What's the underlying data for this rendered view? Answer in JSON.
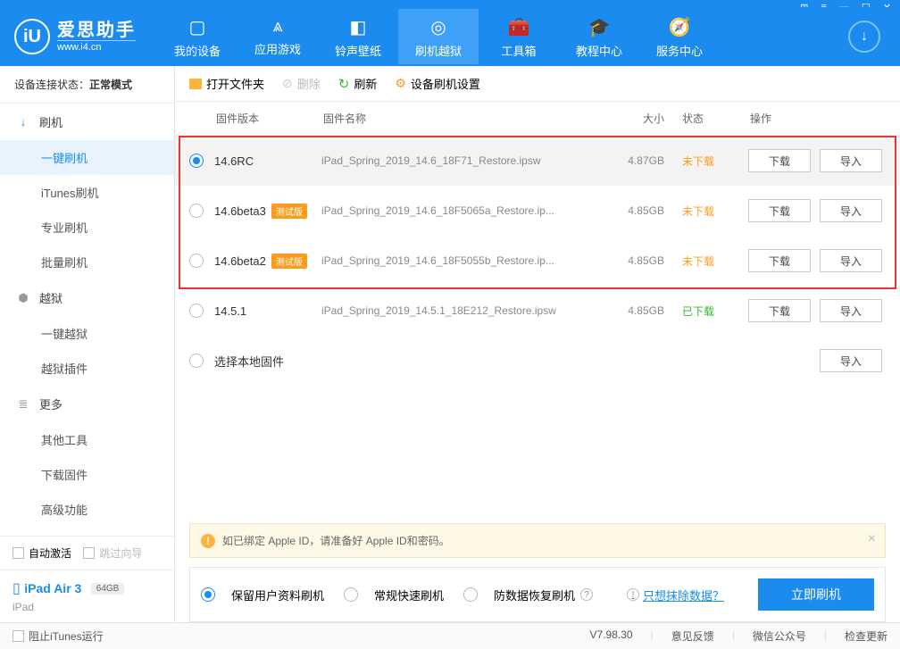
{
  "app": {
    "name": "爱思助手",
    "url": "www.i4.cn"
  },
  "nav": {
    "items": [
      {
        "label": "我的设备",
        "icon": "▢"
      },
      {
        "label": "应用游戏",
        "icon": "⩓"
      },
      {
        "label": "铃声壁纸",
        "icon": "◧"
      },
      {
        "label": "刷机越狱",
        "icon": "◎"
      },
      {
        "label": "工具箱",
        "icon": "🧰"
      },
      {
        "label": "教程中心",
        "icon": "🎓"
      },
      {
        "label": "服务中心",
        "icon": "🧭"
      }
    ],
    "active_index": 3
  },
  "conn": {
    "label": "设备连接状态：",
    "value": "正常模式"
  },
  "sidebar": {
    "flash": {
      "title": "刷机",
      "subs": [
        "一键刷机",
        "iTunes刷机",
        "专业刷机",
        "批量刷机"
      ]
    },
    "jailbreak": {
      "title": "越狱",
      "subs": [
        "一键越狱",
        "越狱插件"
      ]
    },
    "more": {
      "title": "更多",
      "subs": [
        "其他工具",
        "下载固件",
        "高级功能"
      ]
    },
    "auto_activate": "自动激活",
    "skip_guide": "跳过向导"
  },
  "device": {
    "name": "iPad Air 3",
    "storage": "64GB",
    "type": "iPad"
  },
  "toolbar": {
    "open": "打开文件夹",
    "delete": "删除",
    "refresh": "刷新",
    "settings": "设备刷机设置"
  },
  "columns": {
    "version": "固件版本",
    "name": "固件名称",
    "size": "大小",
    "status": "状态",
    "op": "操作"
  },
  "labels": {
    "download": "下载",
    "import": "导入",
    "beta_tag": "测试版",
    "not_downloaded": "未下载",
    "downloaded": "已下载"
  },
  "rows": [
    {
      "version": "14.6RC",
      "beta": false,
      "name": "iPad_Spring_2019_14.6_18F71_Restore.ipsw",
      "size": "4.87GB",
      "status": "nd",
      "selected": true
    },
    {
      "version": "14.6beta3",
      "beta": true,
      "name": "iPad_Spring_2019_14.6_18F5065a_Restore.ip...",
      "size": "4.85GB",
      "status": "nd",
      "selected": false
    },
    {
      "version": "14.6beta2",
      "beta": true,
      "name": "iPad_Spring_2019_14.6_18F5055b_Restore.ip...",
      "size": "4.85GB",
      "status": "nd",
      "selected": false
    },
    {
      "version": "14.5.1",
      "beta": false,
      "name": "iPad_Spring_2019_14.5.1_18E212_Restore.ipsw",
      "size": "4.85GB",
      "status": "dd",
      "selected": false
    }
  ],
  "local_row": {
    "label": "选择本地固件"
  },
  "warn": "如已绑定 Apple ID，请准备好 Apple ID和密码。",
  "flash_opts": {
    "keep": "保留用户资料刷机",
    "normal": "常规快速刷机",
    "anti": "防数据恢复刷机",
    "erase_link": "只想抹除数据？",
    "go": "立即刷机"
  },
  "statusbar": {
    "block_itunes": "阻止iTunes运行",
    "version": "V7.98.30",
    "feedback": "意见反馈",
    "wechat": "微信公众号",
    "update": "检查更新"
  }
}
